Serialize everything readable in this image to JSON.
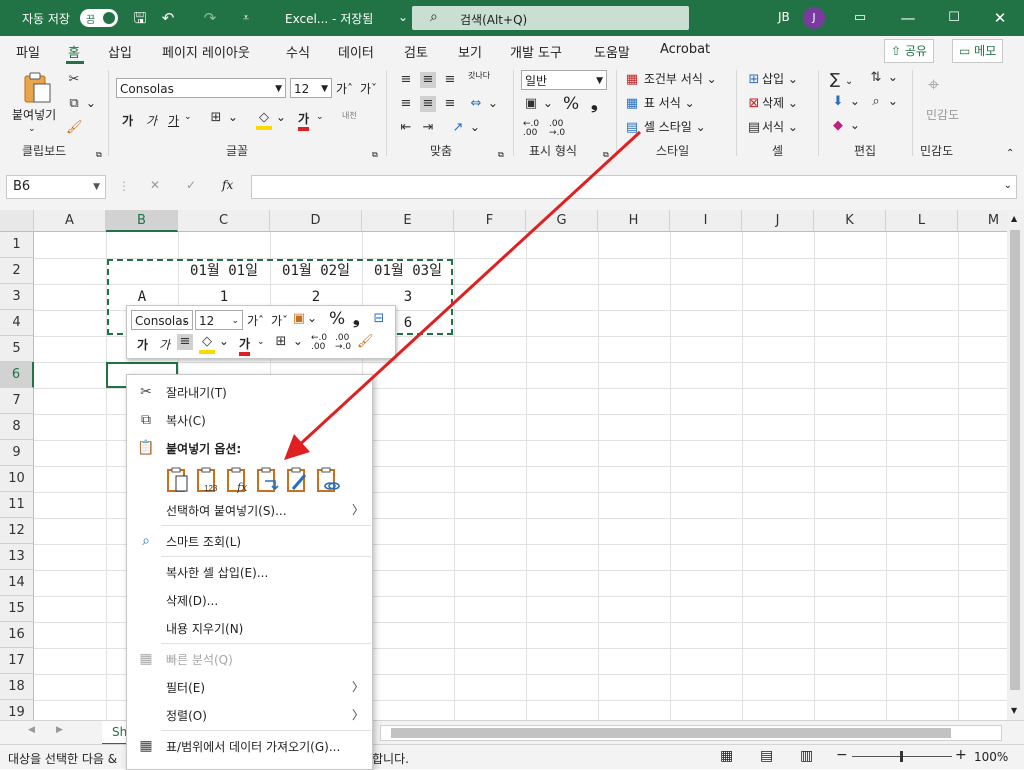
{
  "title_bar": {
    "autosave_label": "자동 저장",
    "autosave_state": "끔",
    "file_title": "Excel... - 저장됨",
    "file_title_dropdown": "⌄",
    "search_label": "검색(Alt+Q)",
    "user_initials": "JB",
    "avatar_letter": "J"
  },
  "ribbon_tabs": [
    "파일",
    "홈",
    "삽입",
    "페이지 레이아웃",
    "수식",
    "데이터",
    "검토",
    "보기",
    "개발 도구",
    "도움말",
    "Acrobat"
  ],
  "share_label": "공유",
  "comments_label": "메모",
  "ribbon": {
    "clipboard": {
      "paste": "붙여넣기",
      "label": "클립보드"
    },
    "font": {
      "font_name": "Consolas",
      "font_size": "12",
      "bold": "가",
      "italic": "가",
      "underline": "가",
      "grow": "가ˆ",
      "shrink": "가ˇ",
      "font_color_glyph": "가",
      "phonetic": "내천",
      "label": "글꼴"
    },
    "alignment": {
      "wrap": "갓나다",
      "label": "맞춤"
    },
    "number": {
      "format": "일반",
      "label": "표시 형식",
      "percent": "%",
      "comma": "❟"
    },
    "styles": {
      "conditional": "조건부 서식",
      "table": "표 서식",
      "cell": "셀 스타일",
      "label": "스타일"
    },
    "cells": {
      "insert": "삽입",
      "delete": "삭제",
      "format": "서식",
      "label": "셀"
    },
    "editing": {
      "label": "편집",
      "sum": "∑"
    },
    "sensitivity": {
      "name": "민감도",
      "label": "민감도"
    }
  },
  "formula_bar": {
    "name_box": "B6",
    "fx": "fx",
    "cancel": "✕",
    "enter": "✓"
  },
  "columns": [
    "A",
    "B",
    "C",
    "D",
    "E",
    "F",
    "G",
    "H",
    "I",
    "J",
    "K",
    "L",
    "M"
  ],
  "rows": [
    "1",
    "2",
    "3",
    "4",
    "5",
    "6",
    "7",
    "8",
    "9",
    "10",
    "11",
    "12",
    "13",
    "14",
    "15",
    "16",
    "17",
    "18",
    "19"
  ],
  "cells": {
    "C2": "01월 01일",
    "D2": "01월 02일",
    "E2": "01월 03일",
    "B3": "A",
    "C3": "1",
    "D3": "2",
    "E3": "3",
    "E4": "6"
  },
  "mini_toolbar": {
    "font": "Consolas",
    "size": "12",
    "grow": "가ˆ",
    "shrink": "가ˇ",
    "percent": "%",
    "comma": "❟",
    "bold": "가",
    "italic": "가",
    "font_color_glyph": "가"
  },
  "context_menu": {
    "items": [
      {
        "label": "잘라내기(T)",
        "icon": "scissors-icon"
      },
      {
        "label": "복사(C)",
        "icon": "copy-icon"
      },
      {
        "label": "붙여넣기 옵션:",
        "icon": "paste-icon"
      },
      {
        "label": "선택하여 붙여넣기(S)...",
        "icon": "none"
      },
      {
        "label": "스마트 조회(L)",
        "icon": "search-icon"
      },
      {
        "label": "복사한 셀 삽입(E)...",
        "icon": "none"
      },
      {
        "label": "삭제(D)...",
        "icon": "none"
      },
      {
        "label": "내용 지우기(N)",
        "icon": "none"
      },
      {
        "label": "빠른 분석(Q)",
        "icon": "quick-analysis-icon"
      },
      {
        "label": "필터(E)",
        "icon": "none"
      },
      {
        "label": "정렬(O)",
        "icon": "none"
      },
      {
        "label": "표/범위에서 데이터 가져오기(G)...",
        "icon": "table-icon"
      }
    ],
    "submenu_glyph": "〉"
  },
  "sheet_tab": "Sh",
  "status": {
    "message": "대상을 선택한 다음 & ",
    "message_tail": "합니다.",
    "zoom": "100%"
  },
  "colors": {
    "excel_green": "#217346",
    "arrow_red": "#e02020",
    "paste_orange": "#c8701c"
  }
}
